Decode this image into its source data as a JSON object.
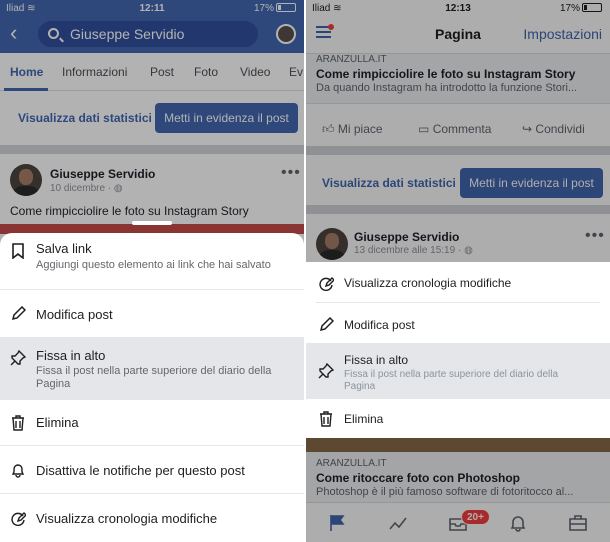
{
  "left": {
    "status": {
      "carrier": "Iliad",
      "time": "12:11",
      "battery": "17%"
    },
    "search_value": "Giuseppe Servidio",
    "tabs": [
      "Home",
      "Informazioni",
      "Post",
      "Foto",
      "Video",
      "Ev"
    ],
    "stats_link": "Visualizza dati statistici",
    "promote_button": "Metti in evidenza il post",
    "post": {
      "author": "Giuseppe Servidio",
      "date": "10 dicembre · ",
      "text": "Come rimpicciolire le foto su Instagram Story"
    },
    "sheet": [
      {
        "title": "Salva link",
        "subtitle": "Aggiungi questo elemento ai link che hai salvato"
      },
      {
        "title": "Modifica post",
        "subtitle": ""
      },
      {
        "title": "Fissa in alto",
        "subtitle": "Fissa il post nella parte superiore del diario della Pagina"
      },
      {
        "title": "Elimina",
        "subtitle": ""
      },
      {
        "title": "Disattiva le notifiche per questo post",
        "subtitle": ""
      },
      {
        "title": "Visualizza cronologia modifiche",
        "subtitle": ""
      }
    ]
  },
  "right": {
    "status": {
      "carrier": "Iliad",
      "time": "12:13",
      "battery": "17%"
    },
    "header": {
      "title": "Pagina",
      "settings": "Impostazioni"
    },
    "link_card": {
      "site": "ARANZULLA.IT",
      "title": "Come rimpicciolire le foto su Instagram Story",
      "description": "Da quando Instagram ha introdotto la funzione Stori..."
    },
    "actions": [
      "Mi piace",
      "Commenta",
      "Condividi"
    ],
    "stats_link": "Visualizza dati statistici",
    "promote_button": "Metti in evidenza il post",
    "post": {
      "author": "Giuseppe Servidio",
      "date": "13 dicembre alle 15:19 · "
    },
    "menu": [
      {
        "title": "Visualizza cronologia modifiche",
        "subtitle": ""
      },
      {
        "title": "Modifica post",
        "subtitle": ""
      },
      {
        "title": "Fissa in alto",
        "subtitle": "Fissa il post nella parte superiore del diario della Pagina"
      },
      {
        "title": "Elimina",
        "subtitle": ""
      }
    ],
    "link_card2": {
      "site": "ARANZULLA.IT",
      "title": "Come ritoccare foto con Photoshop",
      "description": "Photoshop è il più famoso software di fotoritocco al..."
    },
    "notifications_badge": "20+"
  },
  "icons": {
    "bookmark": "bookmark-icon",
    "pencil": "pencil-icon",
    "pin": "pin-icon",
    "trash": "trash-icon",
    "bell": "bell-icon",
    "history": "edit-history-icon"
  },
  "colors": {
    "brand": "#4267b2",
    "badge": "#fa3e3e"
  }
}
